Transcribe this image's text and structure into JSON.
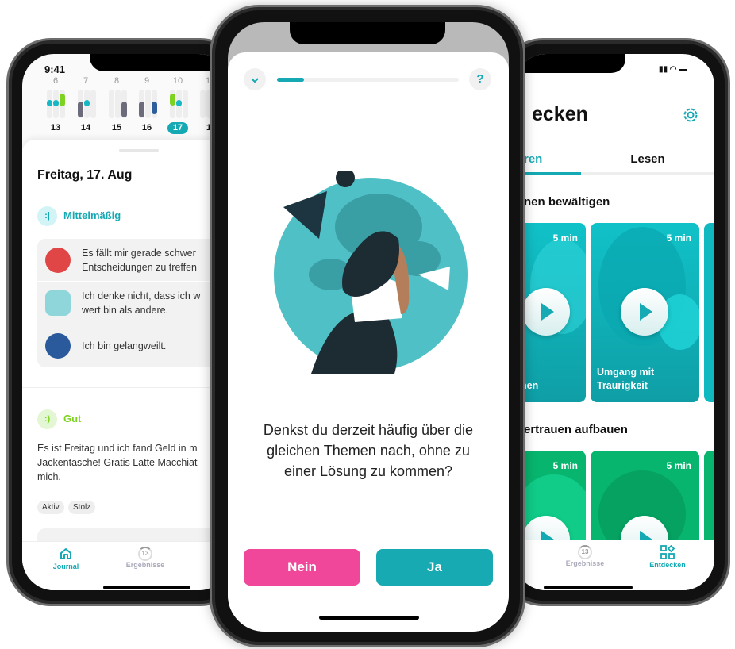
{
  "left_phone": {
    "status_time": "9:41",
    "week_days": [
      "6",
      "7",
      "8",
      "9",
      "10",
      "1"
    ],
    "dates": [
      "13",
      "14",
      "15",
      "16",
      "17",
      "1"
    ],
    "selected_date": "17",
    "day_title": "Freitag, 17. Aug",
    "entries": [
      {
        "mood": "Mittelmäßig",
        "mood_color": "#15a9b3",
        "items": [
          {
            "line1": "Es fällt mir gerade schwer",
            "line2": "Entscheidungen zu treffen"
          },
          {
            "line1": "Ich denke nicht, dass ich w",
            "line2": "wert bin als andere."
          },
          {
            "line1": "Ich bin gelangweilt.",
            "line2": ""
          }
        ]
      },
      {
        "mood": "Gut",
        "mood_color": "#7ed321",
        "note": [
          "Es ist Freitag und ich fand Geld in m",
          "Jackentasche! Gratis Latte Macchiat",
          "mich."
        ],
        "tags": [
          "Aktiv",
          "Stolz"
        ]
      }
    ],
    "tabs": [
      {
        "label": "Journal",
        "icon": "home-icon",
        "active": true
      },
      {
        "label": "Ergebnisse",
        "icon": "progress-ring-icon",
        "badge": "13",
        "active": false
      }
    ]
  },
  "center_phone": {
    "progress_percent": 15,
    "question": [
      "Denkst du derzeit häufig über die",
      "gleichen Themen nach, ohne zu",
      "einer Lösung zu kommen?"
    ],
    "help_label": "?",
    "no_label": "Nein",
    "yes_label": "Ja",
    "colors": {
      "accent": "#15a9b3",
      "no": "#f0479a",
      "yes": "#17aab3"
    }
  },
  "right_phone": {
    "title": "ecken",
    "tabs": [
      {
        "label": "ren",
        "active": true
      },
      {
        "label": "Lesen",
        "active": false
      }
    ],
    "sections": [
      {
        "title": "nen bewältigen",
        "cards": [
          {
            "duration": "5 min",
            "title": [
              "f",
              "nen"
            ]
          },
          {
            "duration": "5 min",
            "title": [
              "Umgang mit",
              "Traurigkeit"
            ]
          }
        ]
      },
      {
        "title": "ertrauen aufbauen",
        "cards": [
          {
            "duration": "5 min"
          },
          {
            "duration": "5 min"
          }
        ]
      }
    ],
    "tabbar": [
      {
        "label": "Ergebnisse",
        "badge": "13",
        "icon": "progress-ring-icon",
        "active": false
      },
      {
        "label": "Entdecken",
        "icon": "grid-shapes-icon",
        "active": true
      }
    ]
  }
}
